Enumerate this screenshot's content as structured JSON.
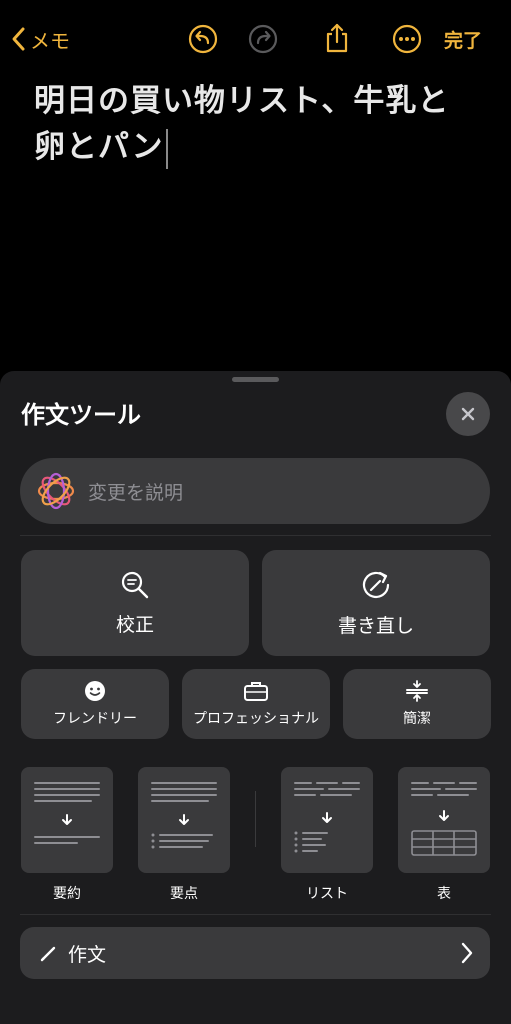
{
  "nav": {
    "back_label": "メモ",
    "done_label": "完了"
  },
  "note": {
    "text": "明日の買い物リスト、牛乳と卵とパン"
  },
  "writing_tools": {
    "title": "作文ツール",
    "describe_placeholder": "変更を説明",
    "proofread_label": "校正",
    "rewrite_label": "書き直し",
    "friendly_label": "フレンドリー",
    "professional_label": "プロフェッショナル",
    "concise_label": "簡潔",
    "summary_label": "要約",
    "key_points_label": "要点",
    "list_label": "リスト",
    "table_label": "表",
    "compose_label": "作文"
  },
  "colors": {
    "accent": "#f0b53d",
    "sheet_bg": "#1c1c1e",
    "button_bg": "#3a3a3c"
  }
}
